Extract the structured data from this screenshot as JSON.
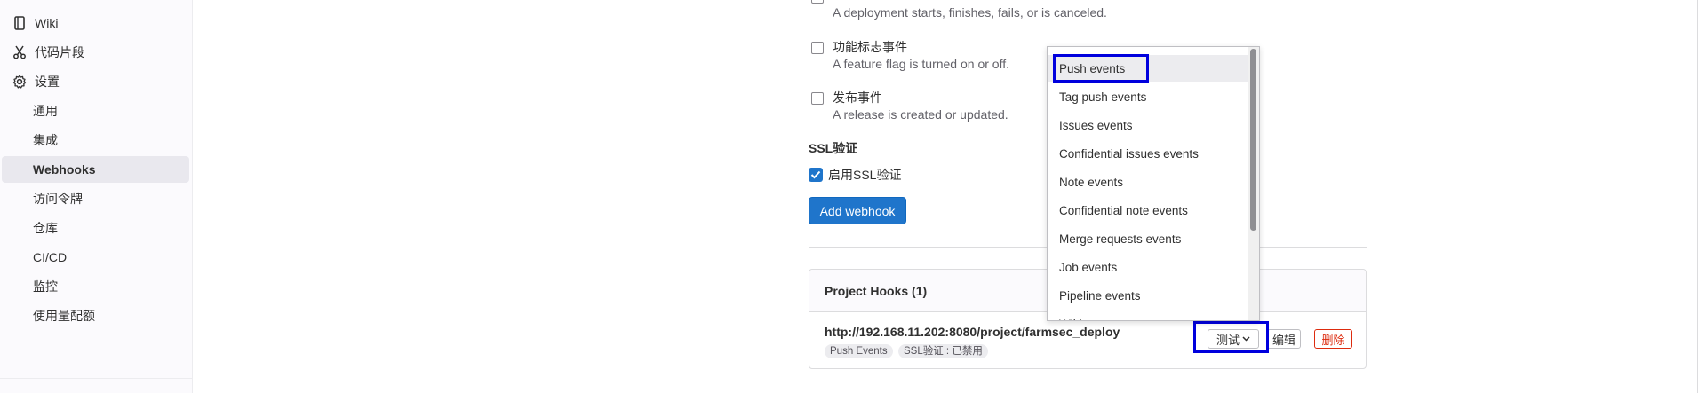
{
  "sidebar": {
    "wiki": "Wiki",
    "snippets": "代码片段",
    "settings": "设置",
    "sub_items": [
      "通用",
      "集成",
      "Webhooks",
      "访问令牌",
      "仓库",
      "CI/CD",
      "监控",
      "使用量配额"
    ]
  },
  "triggers": {
    "deployment_desc": "A deployment starts, finishes, fails, or is canceled.",
    "feature_flag_title": "功能标志事件",
    "feature_flag_desc": "A feature flag is turned on or off.",
    "release_title": "发布事件",
    "release_desc": "A release is created or updated."
  },
  "ssl": {
    "title": "SSL验证",
    "enable_label": "启用SSL验证",
    "checked": true
  },
  "add_webhook_label": "Add webhook",
  "hooks": {
    "title": "Project Hooks (1)",
    "url": "http://192.168.11.202:8080/project/farmsec_deploy",
    "badge_events": "Push Events",
    "badge_ssl": "SSL验证 : 已禁用",
    "test_label": "测试",
    "edit_label": "编辑",
    "delete_label": "删除"
  },
  "dropdown": {
    "items": [
      "Push events",
      "Tag push events",
      "Issues events",
      "Confidential issues events",
      "Note events",
      "Confidential note events",
      "Merge requests events",
      "Job events",
      "Pipeline events",
      "Wiki page events"
    ]
  },
  "colors": {
    "primary": "#1f75cb",
    "danger": "#dd2b0e",
    "highlight": "#0000dd"
  }
}
